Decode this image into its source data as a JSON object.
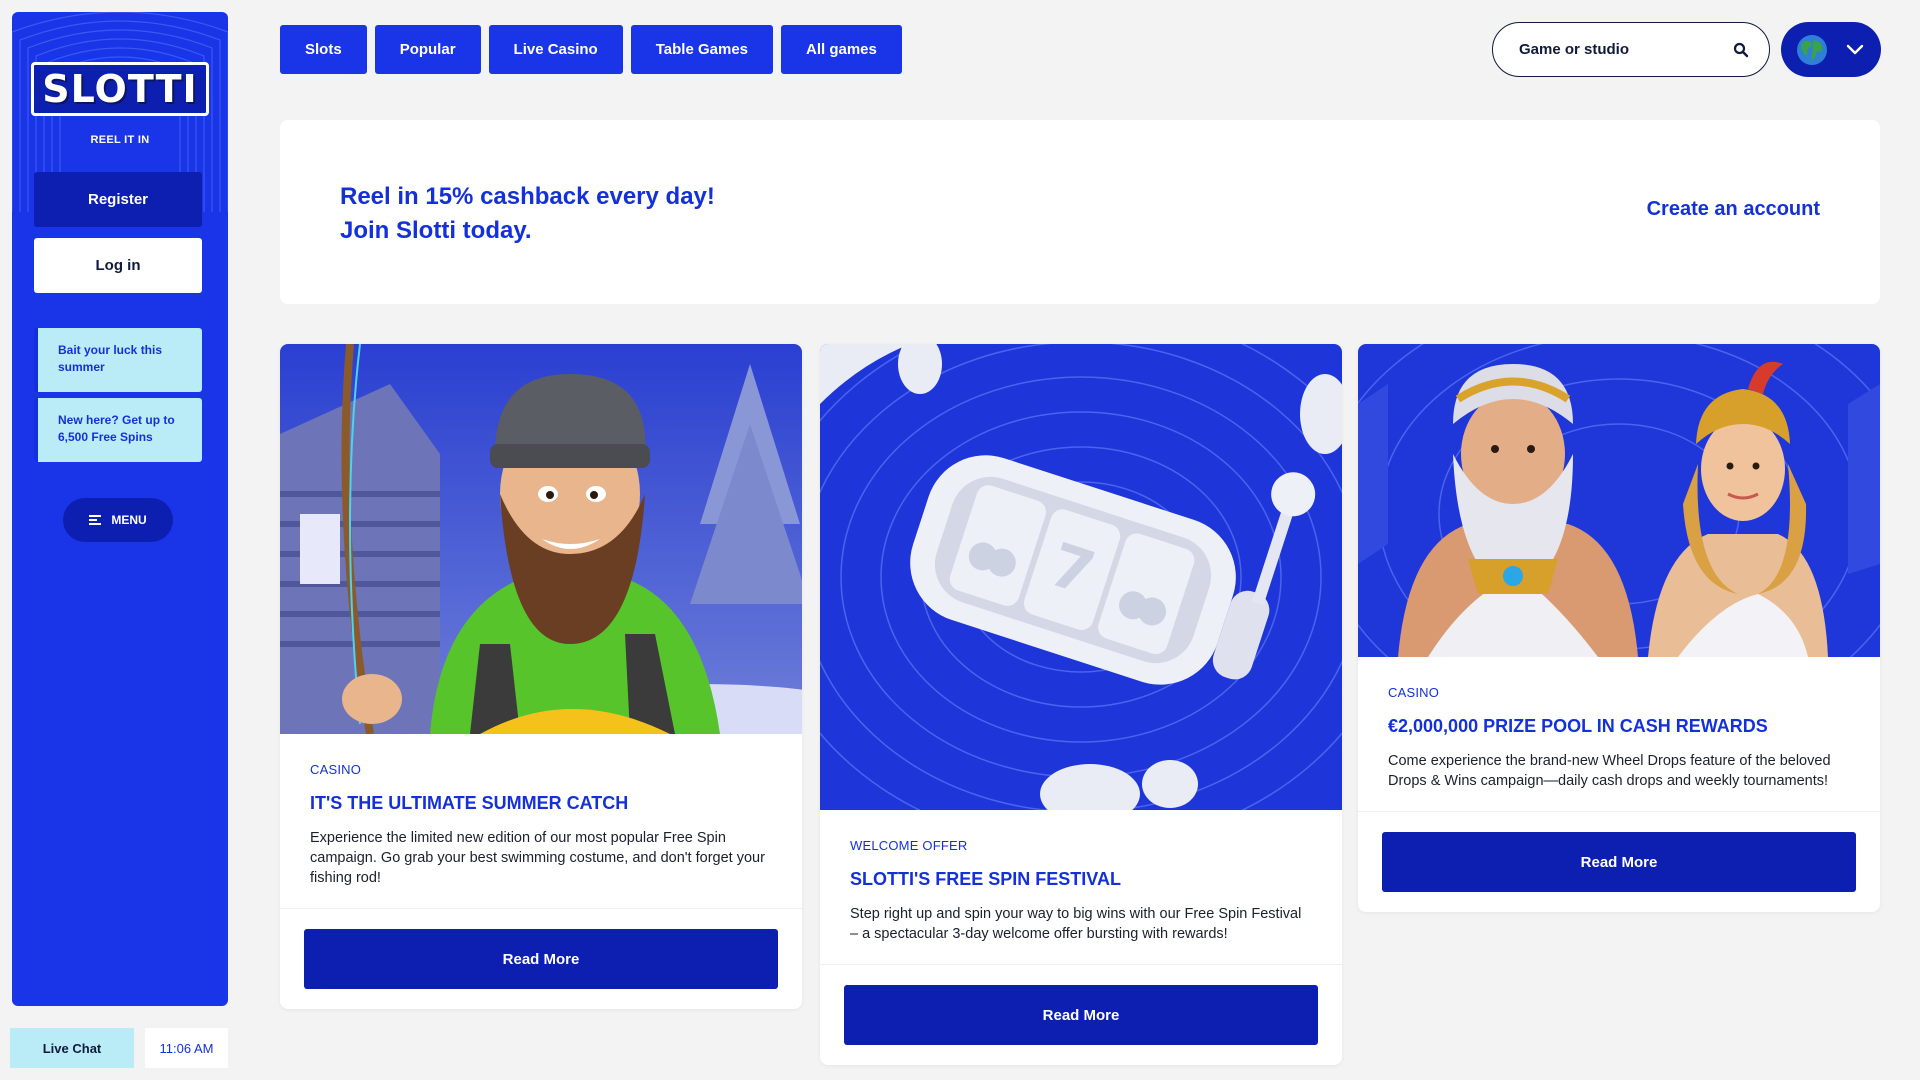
{
  "sidebar": {
    "logo": "SLOTTI",
    "tagline": "REEL IT IN",
    "register_label": "Register",
    "login_label": "Log in",
    "promos": [
      {
        "text": "Bait your luck this summer"
      },
      {
        "text": "New here? Get up to 6,500 Free Spins"
      }
    ],
    "menu_label": "MENU"
  },
  "footer": {
    "live_chat_label": "Live Chat",
    "time": "11:06 AM"
  },
  "nav": {
    "tabs": [
      {
        "label": "Slots"
      },
      {
        "label": "Popular"
      },
      {
        "label": "Live Casino"
      },
      {
        "label": "Table Games"
      },
      {
        "label": "All games"
      }
    ],
    "search_placeholder": "Game or studio",
    "search_icon": "search-icon",
    "language_icon": "globe-icon"
  },
  "banner": {
    "line1": "Reel in 15% cashback every day!",
    "line2": "Join Slotti today.",
    "cta": "Create an account"
  },
  "cards": [
    {
      "category": "CASINO",
      "title": "IT'S THE ULTIMATE SUMMER CATCH",
      "description": "Experience the limited new edition of our most popular Free Spin campaign. Go grab your best swimming costume, and don't forget your fishing rod!",
      "button": "Read More"
    },
    {
      "category": "WELCOME OFFER",
      "title": "SLOTTI'S FREE SPIN FESTIVAL",
      "description": "Step right up and spin your way to big wins with our Free Spin Festival – a spectacular 3-day welcome offer bursting with rewards!",
      "button": "Read More"
    },
    {
      "category": "CASINO",
      "title": "€2,000,000 PRIZE POOL IN CASH REWARDS",
      "description": "Come experience the brand-new Wheel Drops feature of the beloved Drops & Wins campaign—daily cash drops and weekly tournaments!",
      "button": "Read More"
    }
  ],
  "colors": {
    "brand_blue": "#1a35e8",
    "dark_blue": "#0c1fb0",
    "accent_cyan": "#b9ecf7",
    "text_blue": "#1431d9"
  }
}
